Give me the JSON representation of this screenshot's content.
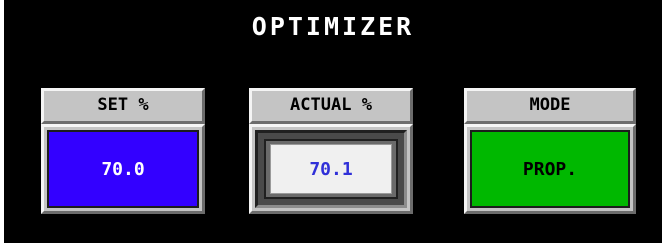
{
  "title": "OPTIMIZER",
  "widgets": [
    {
      "label": "SET %",
      "value": "70.0",
      "fill_color": "#3300ff",
      "text_color": "#ffffff"
    },
    {
      "label": "ACTUAL %",
      "value": "70.1",
      "fill_color": "#f0f0f0",
      "text_color": "#3030d8"
    },
    {
      "label": "MODE",
      "value": "PROP.",
      "fill_color": "#00b800",
      "text_color": "#000000"
    }
  ]
}
